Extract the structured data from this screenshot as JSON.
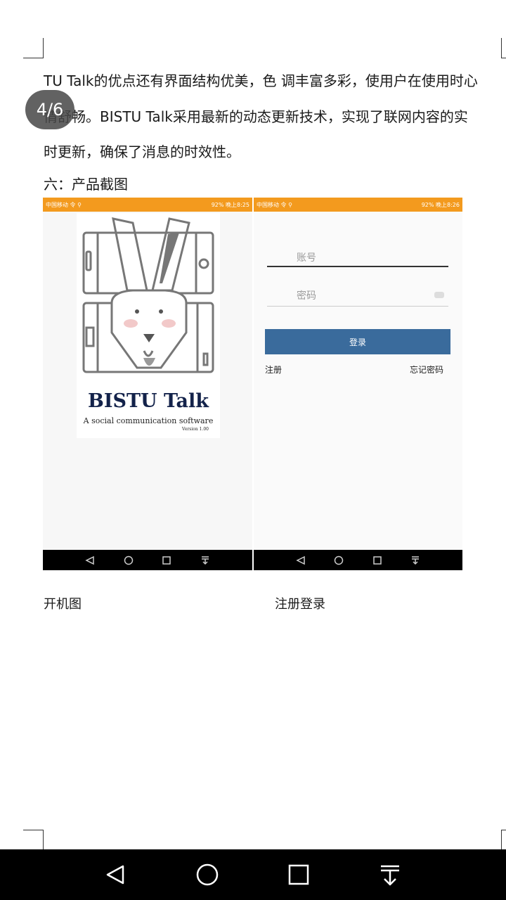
{
  "document": {
    "paragraph_lines": [
      "TU Talk的优点还有界面结构优美，色 调丰富多彩，使用户在使用时心",
      "情舒畅。BISTU Talk采用最新的动态更新技术，实现了联网内容的实",
      "时更新，确保了消息的时效性。"
    ],
    "section_heading": "六：产品截图",
    "page_indicator": "4/6",
    "captions": {
      "left": "开机图",
      "right": "注册登录"
    }
  },
  "screenshots": {
    "status_left_text": "中国移动 令 ⚲",
    "status_right_text_left": "92% 晚上8:25",
    "status_right_text_right": "92% 晚上8:26",
    "splash": {
      "brand": "BISTU Talk",
      "tagline": "A social communication software",
      "version": "Version 1.00"
    },
    "login": {
      "account_placeholder": "账号",
      "password_placeholder": "密码",
      "login_button": "登录",
      "register_link": "注册",
      "forgot_link": "忘记密码",
      "accent_color": "#3a6b9c"
    }
  },
  "system_nav": {
    "icons": [
      "back-icon",
      "home-icon",
      "recents-icon",
      "download-icon"
    ]
  }
}
